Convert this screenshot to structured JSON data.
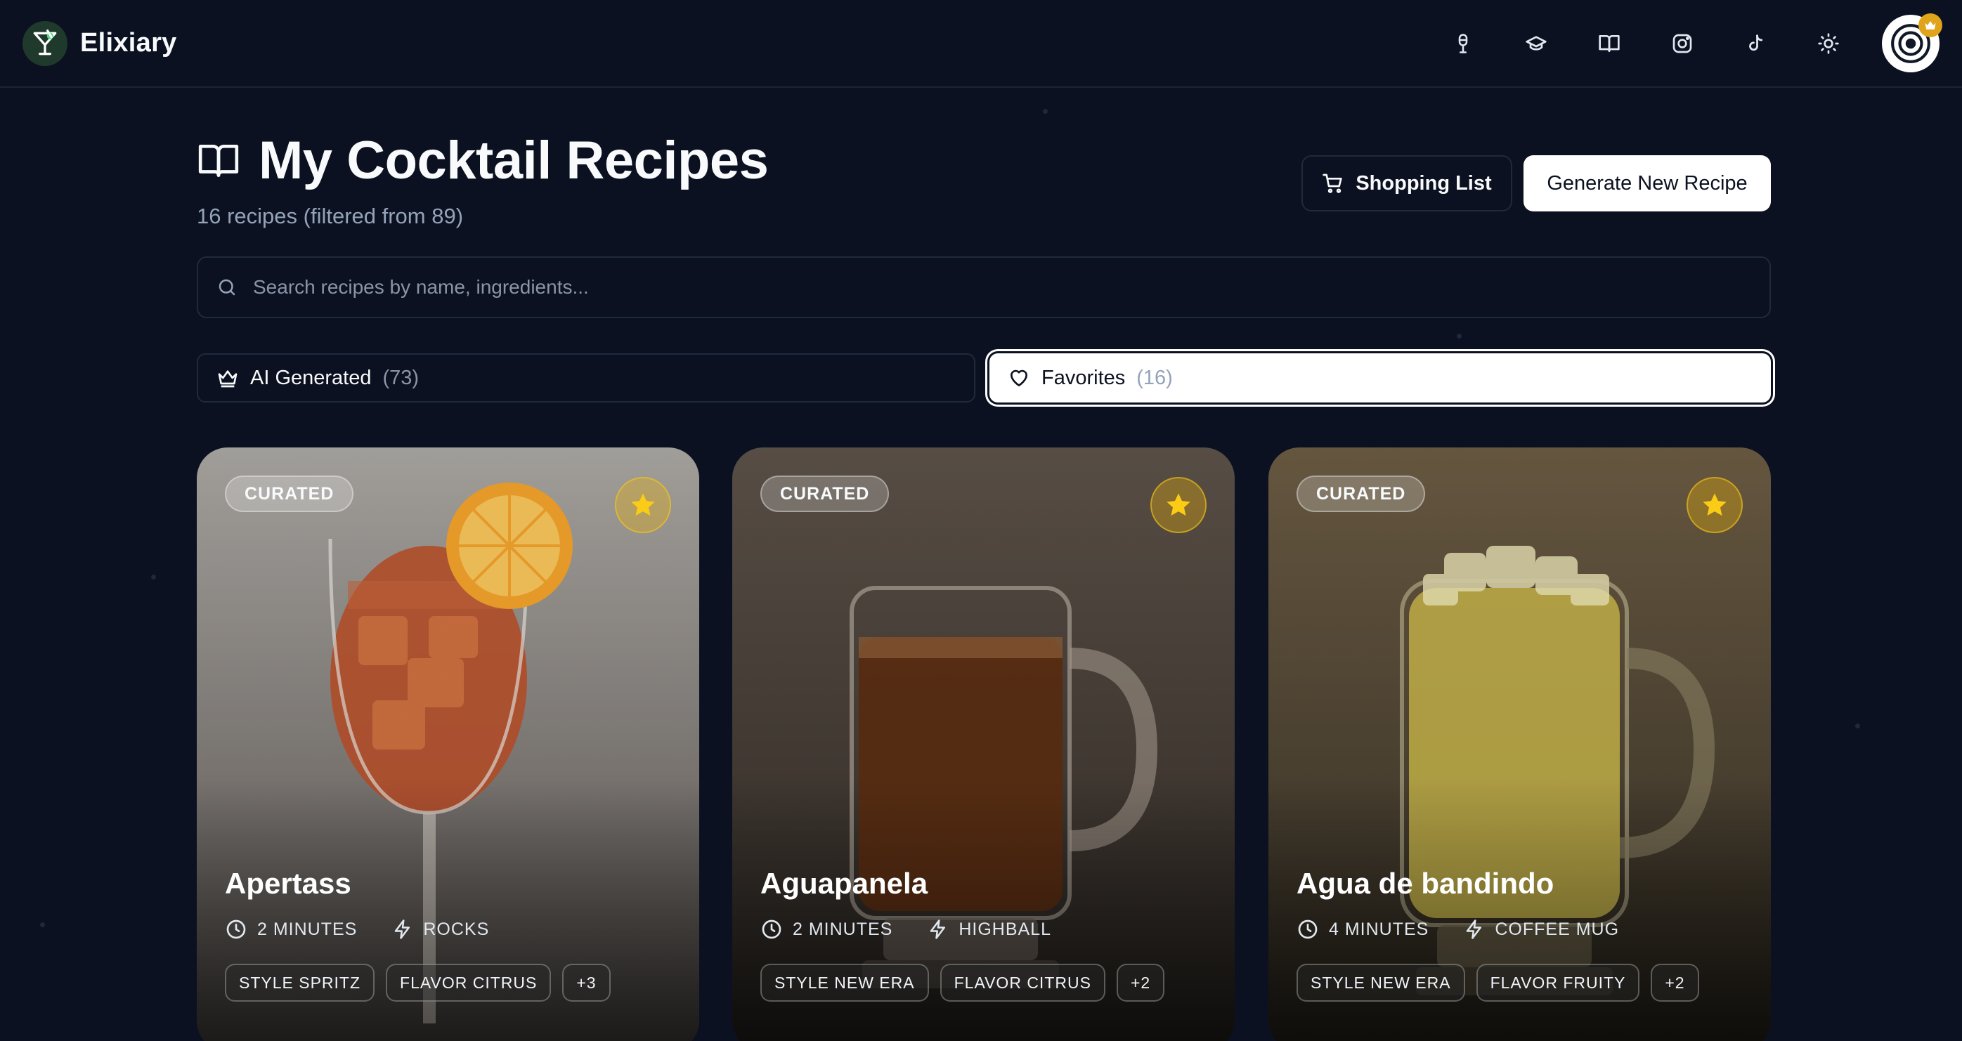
{
  "app": {
    "name": "Elixiary"
  },
  "nav": {
    "icons": [
      "microphone-icon",
      "graduation-cap-icon",
      "book-icon",
      "instagram-icon",
      "tiktok-icon",
      "sun-icon"
    ]
  },
  "page": {
    "title": "My Cocktail Recipes",
    "subtitle": "16 recipes (filtered from 89)"
  },
  "actions": {
    "shopping_list": "Shopping List",
    "generate": "Generate New Recipe"
  },
  "search": {
    "placeholder": "Search recipes by name, ingredients..."
  },
  "filters": {
    "ai": {
      "label": "AI Generated",
      "count": "(73)"
    },
    "favorites": {
      "label": "Favorites",
      "count": "(16)"
    }
  },
  "cards": [
    {
      "badge": "CURATED",
      "name": "Apertass",
      "time": "2 MINUTES",
      "glass": "ROCKS",
      "tags": [
        "STYLE SPRITZ",
        "FLAVOR CITRUS",
        "+3"
      ]
    },
    {
      "badge": "CURATED",
      "name": "Aguapanela",
      "time": "2 MINUTES",
      "glass": "HIGHBALL",
      "tags": [
        "STYLE NEW ERA",
        "FLAVOR CITRUS",
        "+2"
      ]
    },
    {
      "badge": "CURATED",
      "name": "Agua de bandindo",
      "time": "4 MINUTES",
      "glass": "COFFEE MUG",
      "tags": [
        "STYLE NEW ERA",
        "FLAVOR FRUITY",
        "+2"
      ]
    }
  ],
  "colors": {
    "background": "#0b1120",
    "accent_gold": "#facc15",
    "border": "#1f2a3d"
  }
}
